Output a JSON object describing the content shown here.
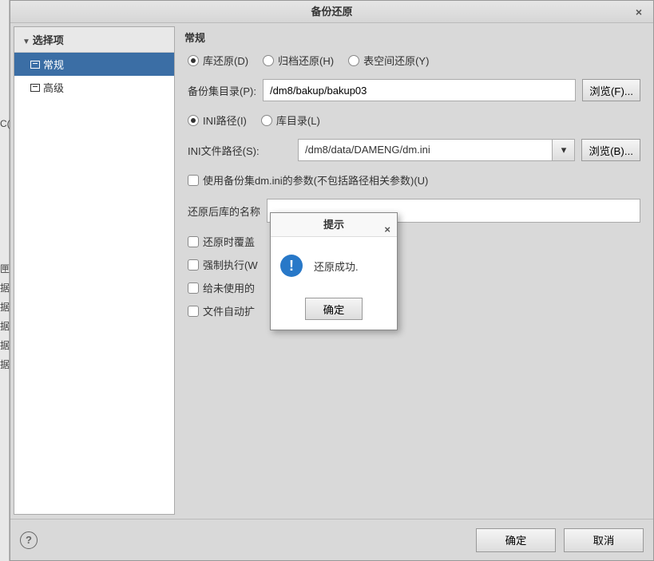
{
  "fragments": {
    "c": "C(",
    "rows": [
      "匣",
      "据",
      "据",
      "据",
      "据",
      "据"
    ]
  },
  "dialog": {
    "title": "备份还原",
    "close": "×"
  },
  "sidebar": {
    "header": "选择项",
    "items": [
      {
        "label": "常规"
      },
      {
        "label": "高级"
      }
    ]
  },
  "main": {
    "section_title": "常规",
    "restore_type": {
      "options": [
        {
          "label": "库还原(D)",
          "checked": true
        },
        {
          "label": "归档还原(H)",
          "checked": false
        },
        {
          "label": "表空间还原(Y)",
          "checked": false
        }
      ]
    },
    "backup_dir": {
      "label": "备份集目录(P):",
      "value": "/dm8/bakup/bakup03",
      "browse": "浏览(F)..."
    },
    "path_type": {
      "options": [
        {
          "label": "INI路径(I)",
          "checked": true
        },
        {
          "label": "库目录(L)",
          "checked": false
        }
      ]
    },
    "ini_path": {
      "label": "INI文件路径(S):",
      "value": "/dm8/data/DAMENG/dm.ini",
      "browse": "浏览(B)..."
    },
    "use_backup_ini": {
      "label": "使用备份集dm.ini的参数(不包括路径相关参数)(U)"
    },
    "restore_db_name": {
      "label": "还原后库的名称"
    },
    "checks": [
      {
        "label": "还原时覆盖"
      },
      {
        "label": "强制执行(W"
      },
      {
        "label": "给未使用的"
      },
      {
        "label": "文件自动扩"
      }
    ]
  },
  "buttons": {
    "ok": "确定",
    "cancel": "取消"
  },
  "modal": {
    "title": "提示",
    "message": "还原成功.",
    "ok": "确定",
    "close": "×"
  }
}
